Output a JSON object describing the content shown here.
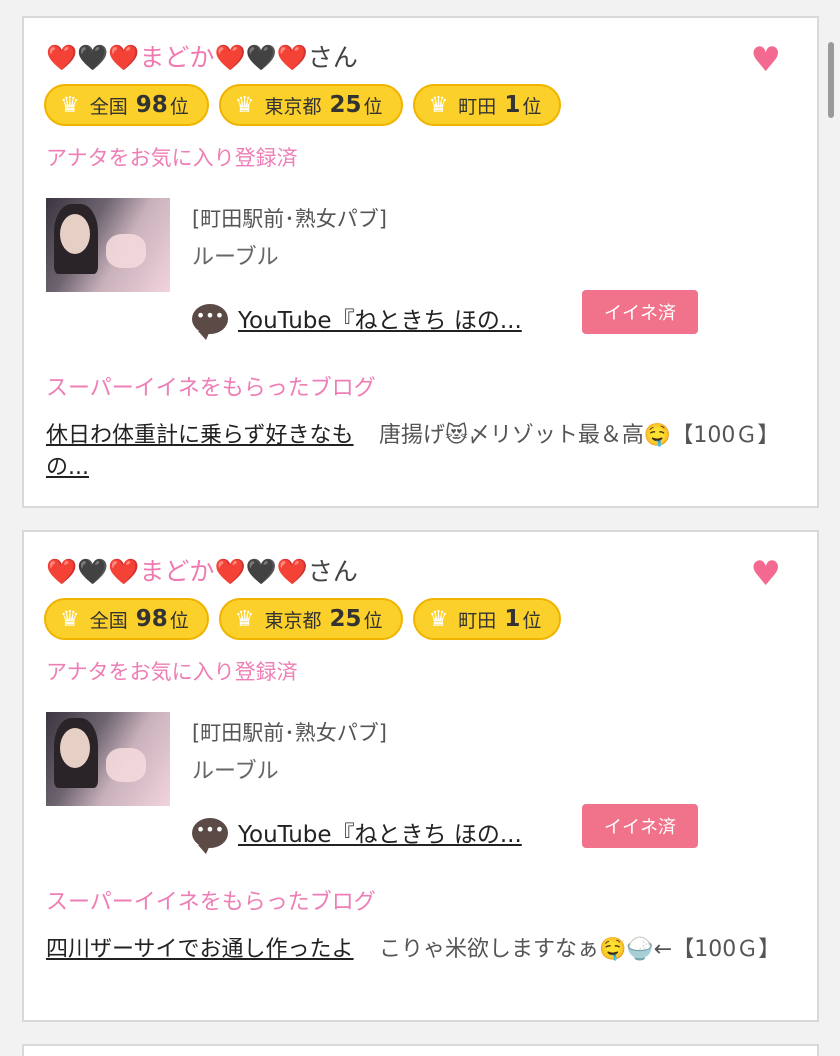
{
  "cards": [
    {
      "name": {
        "hearts_left_1": "❤️",
        "heart_black_1": "🖤",
        "hearts_left_2": "❤️",
        "text": "まどか",
        "hearts_right_1": "❤️",
        "heart_black_2": "🖤",
        "hearts_right_2": "❤️",
        "suffix": "さん"
      },
      "badges": [
        {
          "area": "全国",
          "rank": "98",
          "unit": "位"
        },
        {
          "area": "東京都",
          "rank": "25",
          "unit": "位"
        },
        {
          "area": "町田",
          "rank": "1",
          "unit": "位"
        }
      ],
      "fav_status": "アナタをお気に入り登録済",
      "shop_category": "[町田駅前･熟女パブ]",
      "shop_name": "ルーブル",
      "video_link": "YouTube『ねときち ほの...",
      "iine_label": "イイネ済",
      "super_label": "スーパーイイネをもらったブログ",
      "blog_title": "休日わ体重計に乗らず好きなもの...",
      "blog_comment": "唐揚げ😻〆リゾット最＆高🤤【100Ｇ】"
    },
    {
      "name": {
        "hearts_left_1": "❤️",
        "heart_black_1": "🖤",
        "hearts_left_2": "❤️",
        "text": "まどか",
        "hearts_right_1": "❤️",
        "heart_black_2": "🖤",
        "hearts_right_2": "❤️",
        "suffix": "さん"
      },
      "badges": [
        {
          "area": "全国",
          "rank": "98",
          "unit": "位"
        },
        {
          "area": "東京都",
          "rank": "25",
          "unit": "位"
        },
        {
          "area": "町田",
          "rank": "1",
          "unit": "位"
        }
      ],
      "fav_status": "アナタをお気に入り登録済",
      "shop_category": "[町田駅前･熟女パブ]",
      "shop_name": "ルーブル",
      "video_link": "YouTube『ねときち ほの...",
      "iine_label": "イイネ済",
      "super_label": "スーパーイイネをもらったブログ",
      "blog_title": "四川ザーサイでお通し作ったよ",
      "blog_comment": "こりゃ米欲しますなぁ🤤🍚←【100Ｇ】"
    }
  ],
  "icons": {
    "favorite": "heart-icon",
    "rank": "crown-icon",
    "comment": "speech-bubble-icon"
  },
  "colors": {
    "pink_text": "#ee7eb6",
    "badge_yellow": "#fcd02a",
    "iine_button": "#f0738b",
    "fav_heart": "#f3698f"
  }
}
